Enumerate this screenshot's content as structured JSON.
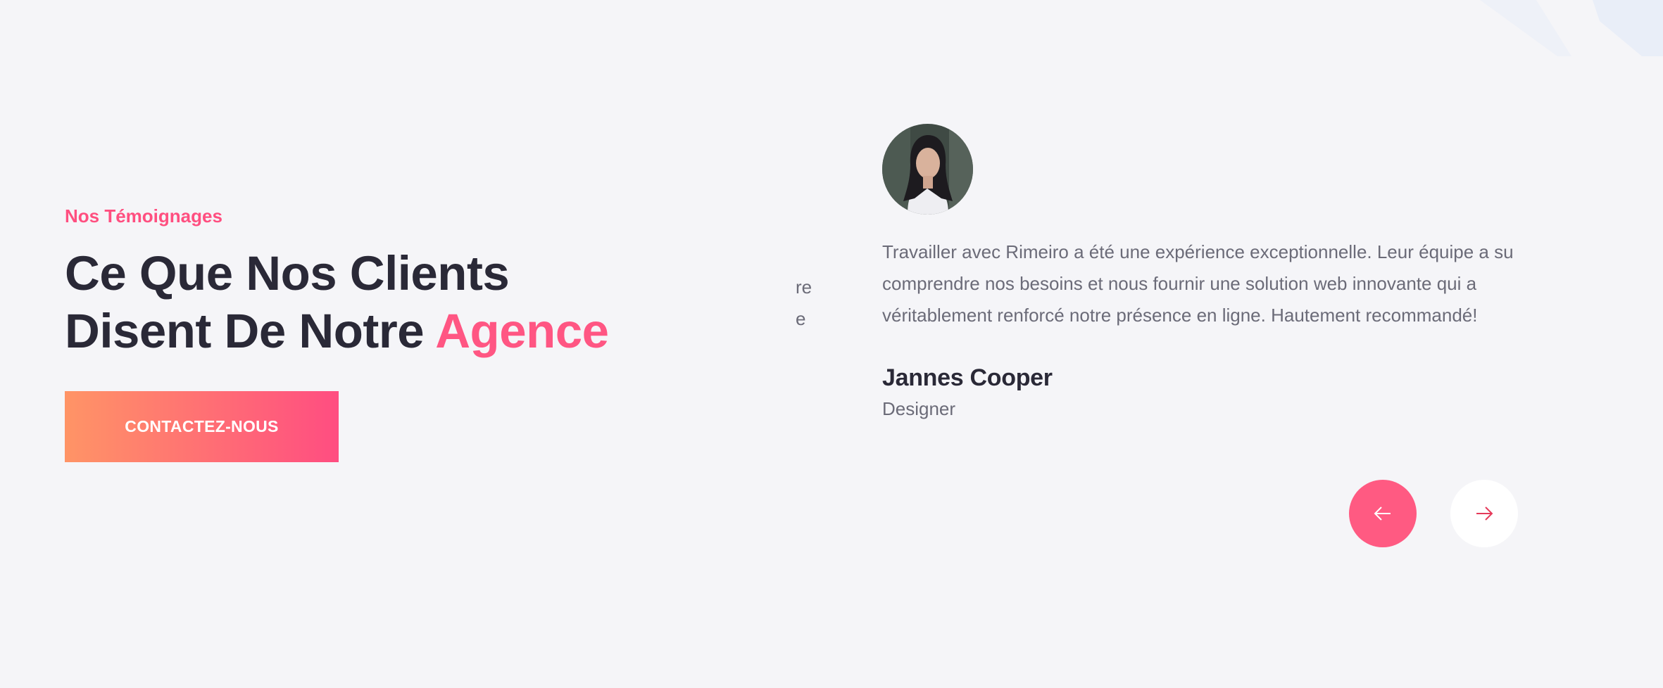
{
  "section": {
    "subtitle": "Nos Témoignages",
    "heading_line1": "Ce Que Nos Clients",
    "heading_line2_prefix": "Disent De Notre ",
    "heading_line2_accent": "Agence",
    "cta_label": "CONTACTEZ-NOUS"
  },
  "carousel": {
    "previous_slide_fragments": [
      "re",
      "e"
    ],
    "current": {
      "quote": "Travailler avec Rimeiro a été une expérience exceptionnelle. Leur équipe a su\ncomprendre nos besoins et nous fournir une solution web innovante qui a\nvéritablement renforcé notre présence en ligne. Hautement recommandé!",
      "name": "Jannes Cooper",
      "role": "Designer"
    },
    "prev_icon": "arrow-left-icon",
    "next_icon": "arrow-right-icon"
  },
  "colors": {
    "background": "#f5f5f8",
    "accent": "#ff5683",
    "heading": "#2a2937",
    "body_text": "#6b6b78",
    "cta_gradient_start": "#ff9466",
    "cta_gradient_end": "#ff4d81"
  }
}
